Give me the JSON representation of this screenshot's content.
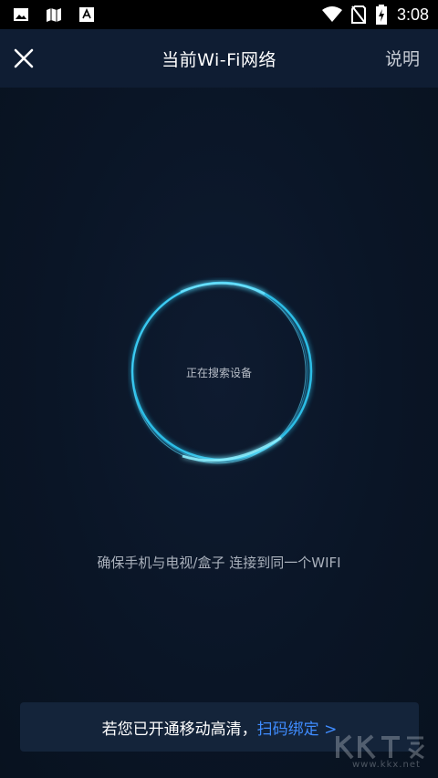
{
  "status_bar": {
    "time": "3:08",
    "icons": [
      "image-icon",
      "map-icon",
      "font-icon",
      "wifi-icon",
      "no-sim-icon",
      "battery-charging-icon"
    ]
  },
  "header": {
    "title": "当前Wi-Fi网络",
    "close_icon": "close-icon",
    "help_label": "说明"
  },
  "search": {
    "status_text": "正在搜索设备"
  },
  "hint": {
    "text": "确保手机与电视/盒子 连接到同一个WIFI"
  },
  "bind_bar": {
    "prefix": "若您已开通移动高清，",
    "link": "扫码绑定 >"
  },
  "watermark": {
    "text": "www.kkx.net"
  },
  "colors": {
    "background": "#0a1526",
    "appbar": "#0f1d33",
    "ring": "#2ec6f0",
    "link": "#3f8cff"
  }
}
